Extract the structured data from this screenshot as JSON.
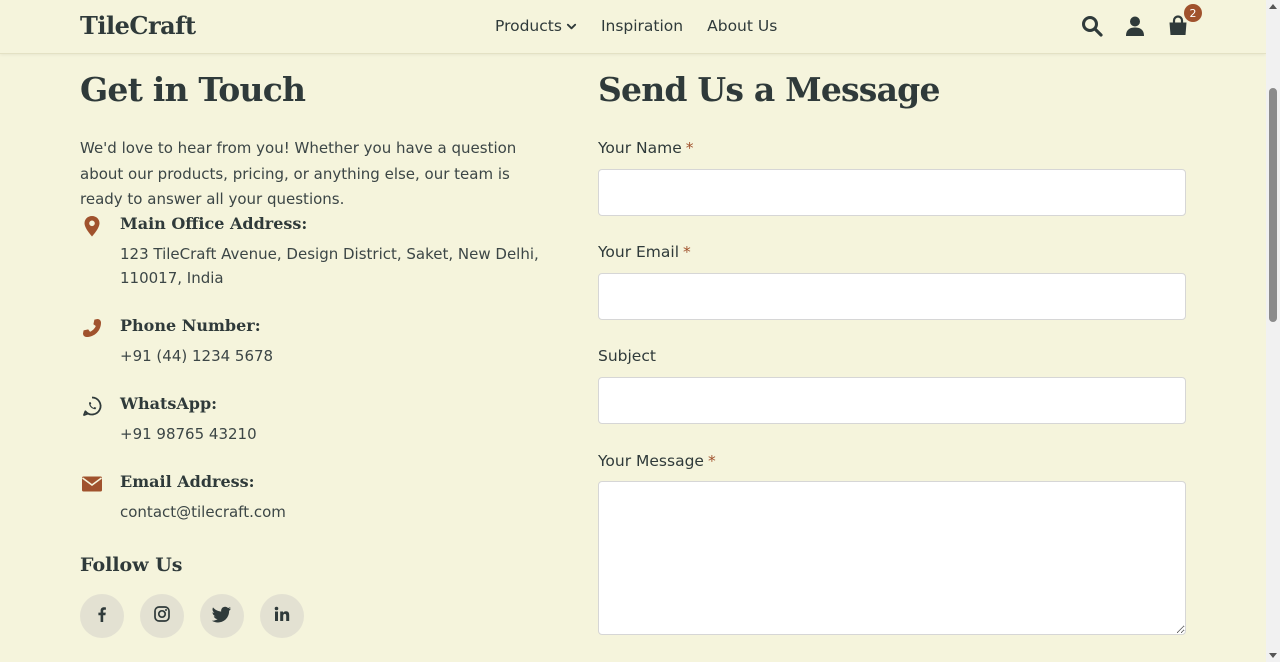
{
  "header": {
    "logo": "TileCraft",
    "nav": [
      "Products",
      "Inspiration",
      "About Us"
    ],
    "cart_count": "2"
  },
  "contact": {
    "title": "Get in Touch",
    "intro": "We'd love to hear from you! Whether you have a question about our products, pricing, or anything else, our team is ready to answer all your questions.",
    "address_title": "Main Office Address:",
    "address_text": "123 TileCraft Avenue, Design District, Saket, New Delhi, 110017, India",
    "phone_title": "Phone Number:",
    "phone_text": "+91 (44) 1234 5678",
    "whatsapp_title": "WhatsApp:",
    "whatsapp_text": "+91 98765 43210",
    "email_title": "Email Address:",
    "email_text": "contact@tilecraft.com",
    "follow_title": "Follow Us"
  },
  "form": {
    "title": "Send Us a Message",
    "name_label": "Your Name",
    "email_label": "Your Email",
    "subject_label": "Subject",
    "message_label": "Your Message",
    "required_mark": "*"
  },
  "colors": {
    "background": "#f5f4dc",
    "accent": "#a0522d",
    "text": "#2f3a3a"
  }
}
